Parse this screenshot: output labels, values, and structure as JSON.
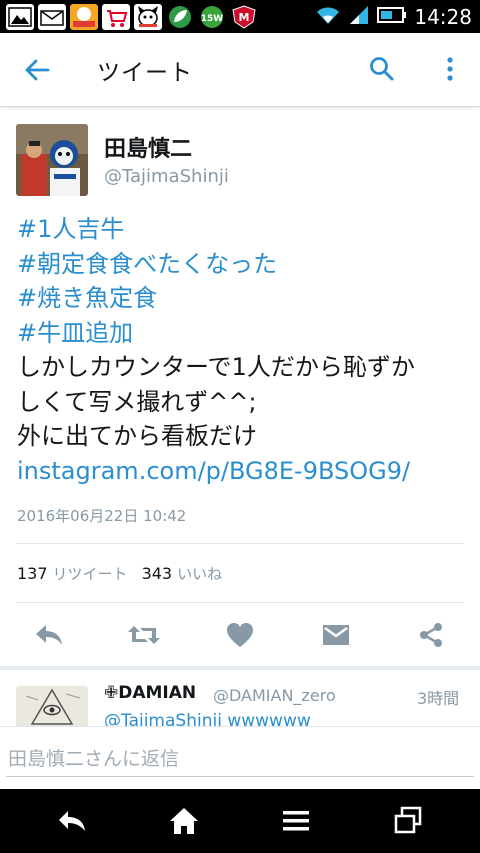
{
  "status_bar": {
    "time": "14:28",
    "icons": [
      "image-icon",
      "mail-icon",
      "cookpad-icon",
      "yahoo-shopping-icon",
      "dog-icon",
      "leaf-icon",
      "15w-icon",
      "mcafee-icon"
    ],
    "badge_15w": "15W",
    "badge_m": "M"
  },
  "appbar": {
    "title": "ツイート"
  },
  "tweet": {
    "author_name": "田島慎二",
    "author_handle": "@TajimaShinji",
    "lines": [
      {
        "text": "#1人吉牛",
        "type": "hashtag"
      },
      {
        "text": "#朝定食食べたくなった",
        "type": "hashtag"
      },
      {
        "text": "#焼き魚定食",
        "type": "hashtag"
      },
      {
        "text": "#牛皿追加",
        "type": "hashtag"
      },
      {
        "text": "しかしカウンターで1人だから恥ずか",
        "type": "text"
      },
      {
        "text": "しくて写メ撮れず^^;",
        "type": "text"
      },
      {
        "text": "外に出てから看板だけ",
        "type": "text"
      },
      {
        "text": "instagram.com/p/BG8E-9BSOG9/",
        "type": "link"
      }
    ],
    "timestamp": "2016年06月22日 10:42",
    "retweet_count": "137",
    "retweet_label": "リツイート",
    "like_count": "343",
    "like_label": "いいね"
  },
  "reply": {
    "name": "DAMIAN",
    "name_prefix": "✙",
    "handle": "@DAMIAN_zero",
    "time": "3時間",
    "text": "@TajimaShinji wwwwww"
  },
  "compose": {
    "placeholder": "田島慎二さんに返信"
  },
  "colors": {
    "accent": "#2a8ed0",
    "text": "#14171a",
    "muted": "#8899a6",
    "action_icon": "#8899a6"
  }
}
